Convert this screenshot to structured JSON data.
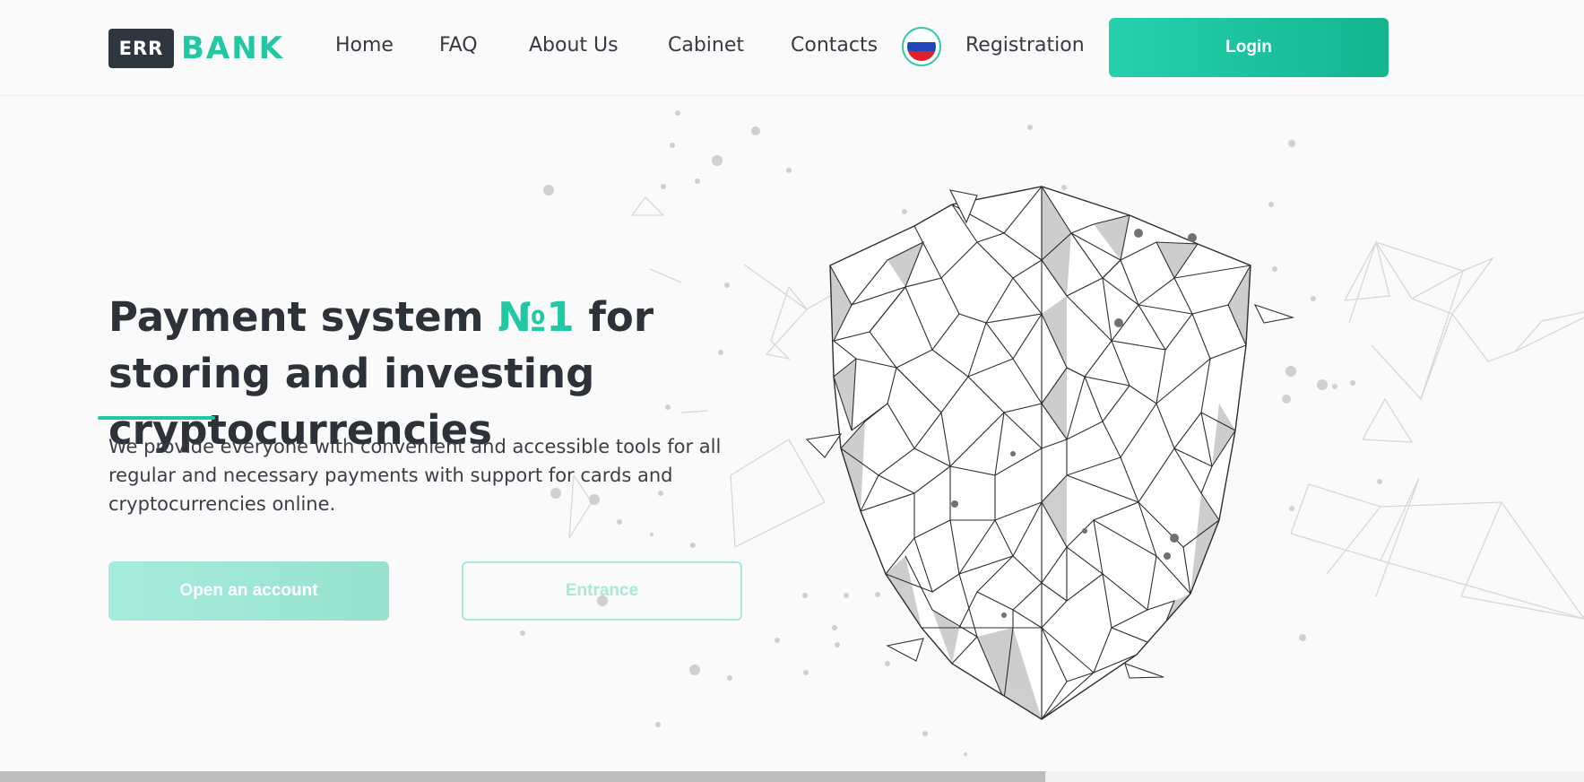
{
  "header": {
    "logo": {
      "badge": "ERR",
      "name": "BANK"
    },
    "nav": [
      {
        "label": "Home"
      },
      {
        "label": "FAQ"
      },
      {
        "label": "About Us"
      },
      {
        "label": "Cabinet"
      },
      {
        "label": "Contacts"
      }
    ],
    "language_icon": "russia-flag-icon",
    "registration_label": "Registration",
    "login_label": "Login"
  },
  "hero": {
    "title_part1": "Payment system ",
    "title_accent": "№1",
    "title_part2": " for storing and investing cryptocurrencies",
    "description": "We provide everyone with convenient and accessible tools for all regular and necessary payments with support for cards and cryptocurrencies online.",
    "open_account_label": "Open an account",
    "entrance_label": "Entrance"
  },
  "colors": {
    "accent": "#22c7a4",
    "dark": "#2e3640",
    "button_gradient_start": "#25d1ac",
    "button_gradient_end": "#14b58f"
  },
  "scroll_progress": 0.66
}
